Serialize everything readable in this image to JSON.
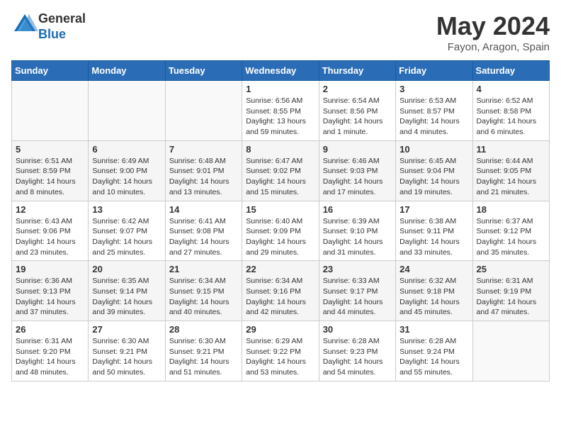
{
  "logo": {
    "general": "General",
    "blue": "Blue"
  },
  "title": "May 2024",
  "location": "Fayon, Aragon, Spain",
  "days_of_week": [
    "Sunday",
    "Monday",
    "Tuesday",
    "Wednesday",
    "Thursday",
    "Friday",
    "Saturday"
  ],
  "weeks": [
    [
      {
        "day": "",
        "info": ""
      },
      {
        "day": "",
        "info": ""
      },
      {
        "day": "",
        "info": ""
      },
      {
        "day": "1",
        "info": "Sunrise: 6:56 AM\nSunset: 8:55 PM\nDaylight: 13 hours and 59 minutes."
      },
      {
        "day": "2",
        "info": "Sunrise: 6:54 AM\nSunset: 8:56 PM\nDaylight: 14 hours and 1 minute."
      },
      {
        "day": "3",
        "info": "Sunrise: 6:53 AM\nSunset: 8:57 PM\nDaylight: 14 hours and 4 minutes."
      },
      {
        "day": "4",
        "info": "Sunrise: 6:52 AM\nSunset: 8:58 PM\nDaylight: 14 hours and 6 minutes."
      }
    ],
    [
      {
        "day": "5",
        "info": "Sunrise: 6:51 AM\nSunset: 8:59 PM\nDaylight: 14 hours and 8 minutes."
      },
      {
        "day": "6",
        "info": "Sunrise: 6:49 AM\nSunset: 9:00 PM\nDaylight: 14 hours and 10 minutes."
      },
      {
        "day": "7",
        "info": "Sunrise: 6:48 AM\nSunset: 9:01 PM\nDaylight: 14 hours and 13 minutes."
      },
      {
        "day": "8",
        "info": "Sunrise: 6:47 AM\nSunset: 9:02 PM\nDaylight: 14 hours and 15 minutes."
      },
      {
        "day": "9",
        "info": "Sunrise: 6:46 AM\nSunset: 9:03 PM\nDaylight: 14 hours and 17 minutes."
      },
      {
        "day": "10",
        "info": "Sunrise: 6:45 AM\nSunset: 9:04 PM\nDaylight: 14 hours and 19 minutes."
      },
      {
        "day": "11",
        "info": "Sunrise: 6:44 AM\nSunset: 9:05 PM\nDaylight: 14 hours and 21 minutes."
      }
    ],
    [
      {
        "day": "12",
        "info": "Sunrise: 6:43 AM\nSunset: 9:06 PM\nDaylight: 14 hours and 23 minutes."
      },
      {
        "day": "13",
        "info": "Sunrise: 6:42 AM\nSunset: 9:07 PM\nDaylight: 14 hours and 25 minutes."
      },
      {
        "day": "14",
        "info": "Sunrise: 6:41 AM\nSunset: 9:08 PM\nDaylight: 14 hours and 27 minutes."
      },
      {
        "day": "15",
        "info": "Sunrise: 6:40 AM\nSunset: 9:09 PM\nDaylight: 14 hours and 29 minutes."
      },
      {
        "day": "16",
        "info": "Sunrise: 6:39 AM\nSunset: 9:10 PM\nDaylight: 14 hours and 31 minutes."
      },
      {
        "day": "17",
        "info": "Sunrise: 6:38 AM\nSunset: 9:11 PM\nDaylight: 14 hours and 33 minutes."
      },
      {
        "day": "18",
        "info": "Sunrise: 6:37 AM\nSunset: 9:12 PM\nDaylight: 14 hours and 35 minutes."
      }
    ],
    [
      {
        "day": "19",
        "info": "Sunrise: 6:36 AM\nSunset: 9:13 PM\nDaylight: 14 hours and 37 minutes."
      },
      {
        "day": "20",
        "info": "Sunrise: 6:35 AM\nSunset: 9:14 PM\nDaylight: 14 hours and 39 minutes."
      },
      {
        "day": "21",
        "info": "Sunrise: 6:34 AM\nSunset: 9:15 PM\nDaylight: 14 hours and 40 minutes."
      },
      {
        "day": "22",
        "info": "Sunrise: 6:34 AM\nSunset: 9:16 PM\nDaylight: 14 hours and 42 minutes."
      },
      {
        "day": "23",
        "info": "Sunrise: 6:33 AM\nSunset: 9:17 PM\nDaylight: 14 hours and 44 minutes."
      },
      {
        "day": "24",
        "info": "Sunrise: 6:32 AM\nSunset: 9:18 PM\nDaylight: 14 hours and 45 minutes."
      },
      {
        "day": "25",
        "info": "Sunrise: 6:31 AM\nSunset: 9:19 PM\nDaylight: 14 hours and 47 minutes."
      }
    ],
    [
      {
        "day": "26",
        "info": "Sunrise: 6:31 AM\nSunset: 9:20 PM\nDaylight: 14 hours and 48 minutes."
      },
      {
        "day": "27",
        "info": "Sunrise: 6:30 AM\nSunset: 9:21 PM\nDaylight: 14 hours and 50 minutes."
      },
      {
        "day": "28",
        "info": "Sunrise: 6:30 AM\nSunset: 9:21 PM\nDaylight: 14 hours and 51 minutes."
      },
      {
        "day": "29",
        "info": "Sunrise: 6:29 AM\nSunset: 9:22 PM\nDaylight: 14 hours and 53 minutes."
      },
      {
        "day": "30",
        "info": "Sunrise: 6:28 AM\nSunset: 9:23 PM\nDaylight: 14 hours and 54 minutes."
      },
      {
        "day": "31",
        "info": "Sunrise: 6:28 AM\nSunset: 9:24 PM\nDaylight: 14 hours and 55 minutes."
      },
      {
        "day": "",
        "info": ""
      }
    ]
  ]
}
